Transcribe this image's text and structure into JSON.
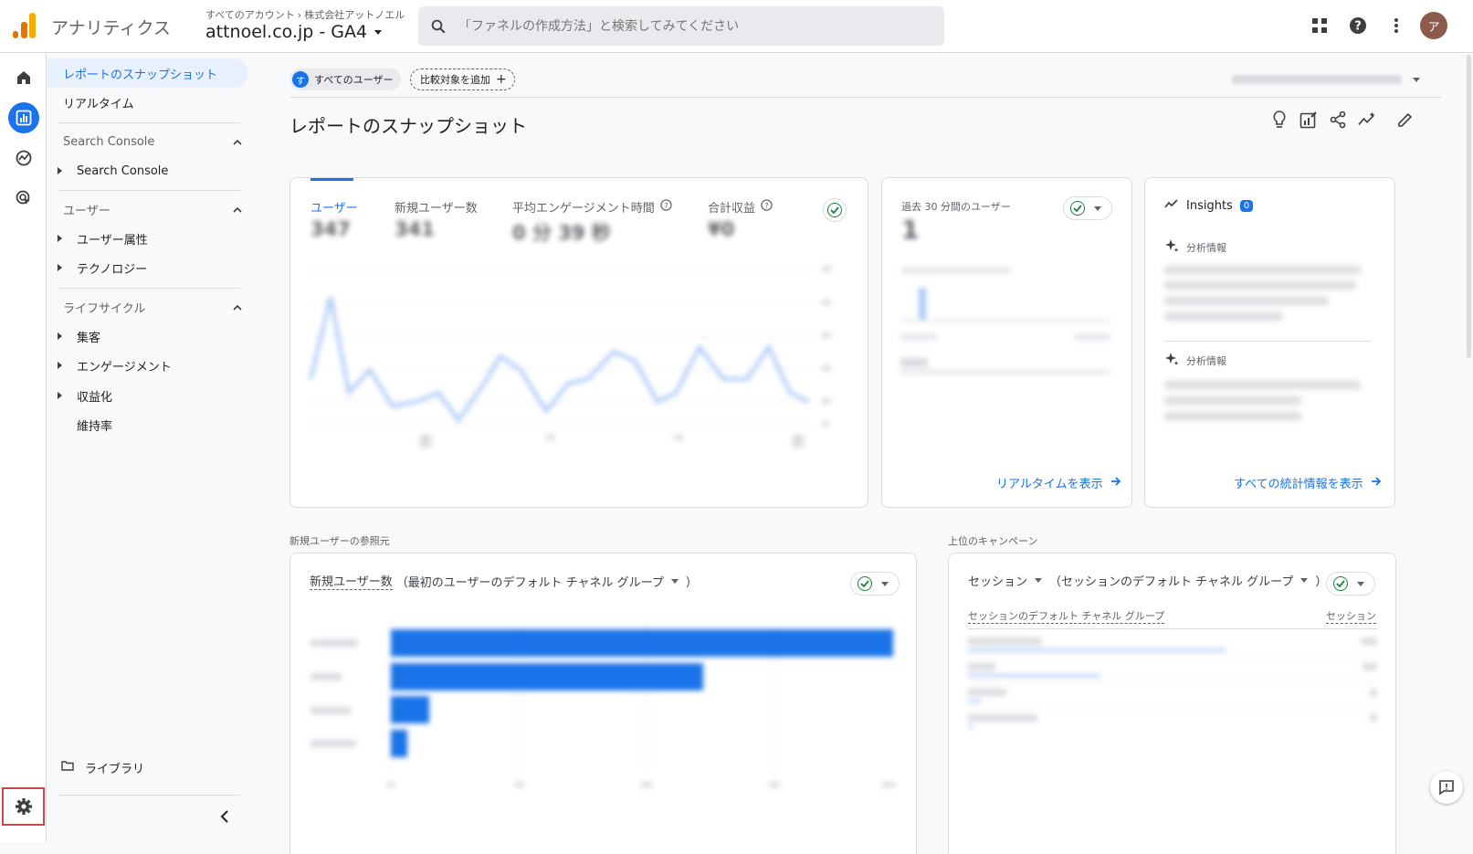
{
  "header": {
    "app_title": "アナリティクス",
    "breadcrumb_root": "すべてのアカウント",
    "breadcrumb_account": "株式会社アットノエル",
    "property_name": "attnoel.co.jp - GA4",
    "search_placeholder": "「ファネルの作成方法」と検索してみてください",
    "avatar_initial": "ア"
  },
  "nav": {
    "snapshot": "レポートのスナップショット",
    "realtime": "リアルタイム",
    "section_search_console": "Search Console",
    "search_console_item": "Search Console",
    "section_user": "ユーザー",
    "user_attributes": "ユーザー属性",
    "technology": "テクノロジー",
    "section_lifecycle": "ライフサイクル",
    "acquisition": "集客",
    "engagement": "エンゲージメント",
    "monetization": "収益化",
    "retention": "維持率",
    "library": "ライブラリ"
  },
  "main": {
    "chip_all_users_initial": "す",
    "chip_all_users": "すべてのユーザー",
    "chip_add_comparison": "比較対象を追加",
    "page_title": "レポートのスナップショット",
    "metrics": [
      {
        "label": "ユーザー",
        "value": "347"
      },
      {
        "label": "新規ユーザー数",
        "value": "341"
      },
      {
        "label": "平均エンゲージメント時間",
        "value": "0 分 39 秒"
      },
      {
        "label": "合計収益",
        "value": "¥0"
      }
    ],
    "realtime_card_title": "過去 30 分間のユーザー",
    "realtime_value": "1",
    "realtime_link": "リアルタイムを表示",
    "insights_title": "Insights",
    "insights_count": "0",
    "insight_label": "分析情報",
    "insights_link": "すべての統計情報を表示",
    "section_new_user_source": "新規ユーザーの参照元",
    "new_user_card_metric": "新規ユーザー数",
    "new_user_card_dimension": "（最初のユーザーのデフォルト チャネル グループ",
    "new_user_card_close": "）",
    "section_top_campaign": "上位のキャンペーン",
    "campaign_card_metric": "セッション",
    "campaign_card_dimension": "（セッションのデフォルト チャネル グループ",
    "campaign_card_close": "）",
    "campaign_col_dimension": "セッションのデフォルト チャネル グループ",
    "campaign_col_metric": "セッション"
  },
  "colors": {
    "accent": "#1a73e8",
    "success": "#188038",
    "settings_highlight": "#c5494b"
  }
}
